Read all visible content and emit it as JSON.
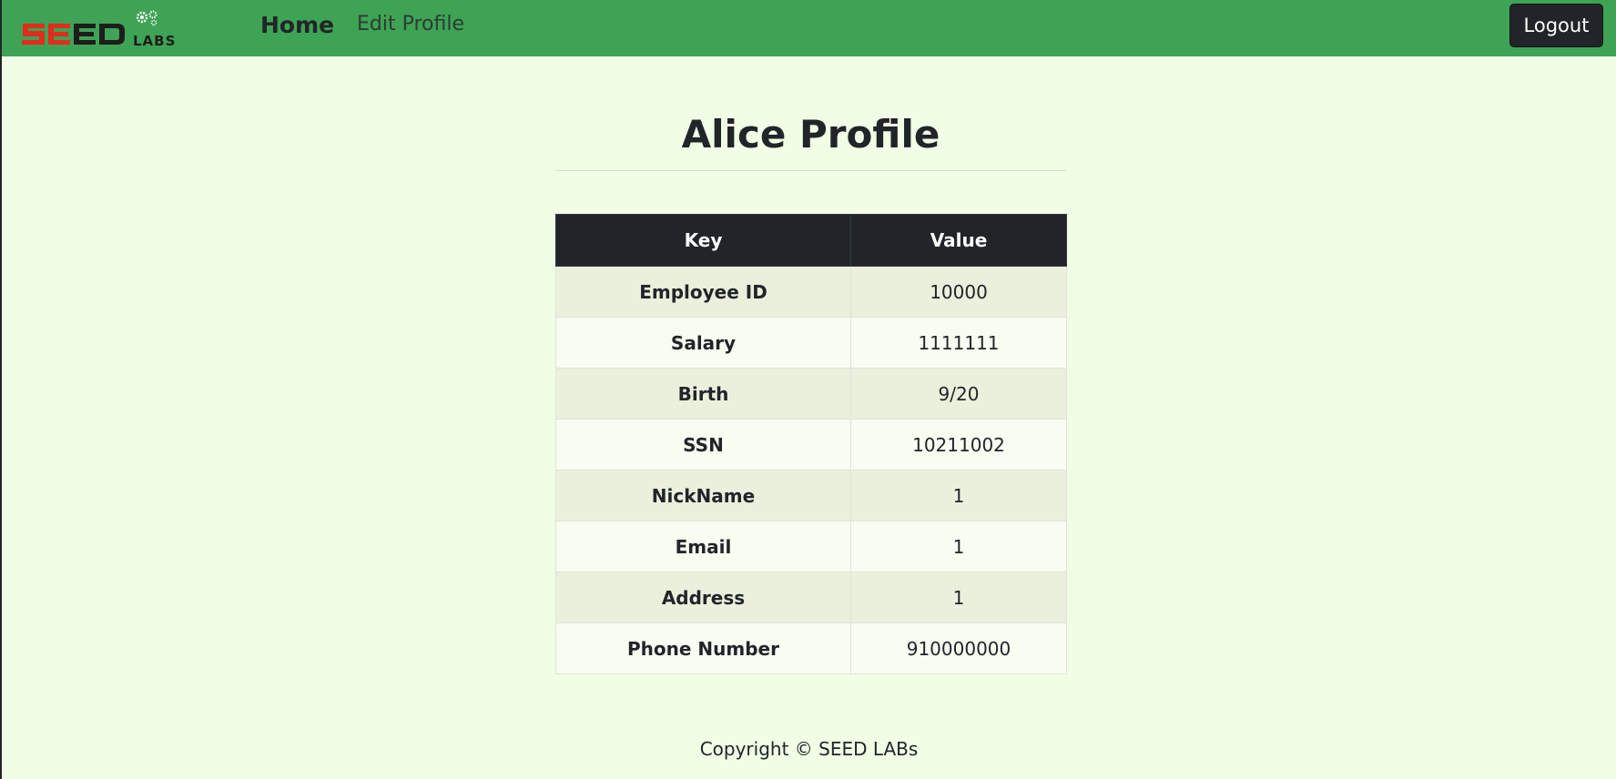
{
  "navbar": {
    "logo_alt": "SEED LABS",
    "home_label": "Home",
    "edit_profile_label": "Edit Profile",
    "logout_label": "Logout",
    "background_color": "#3ea355"
  },
  "main": {
    "title": "Alice Profile",
    "table": {
      "headers": [
        "Key",
        "Value"
      ],
      "rows": [
        {
          "key": "Employee ID",
          "value": "10000"
        },
        {
          "key": "Salary",
          "value": "1111111"
        },
        {
          "key": "Birth",
          "value": "9/20"
        },
        {
          "key": "SSN",
          "value": "10211002"
        },
        {
          "key": "NickName",
          "value": "1"
        },
        {
          "key": "Email",
          "value": "1"
        },
        {
          "key": "Address",
          "value": "1"
        },
        {
          "key": "Phone Number",
          "value": "910000000"
        }
      ]
    }
  },
  "footer": {
    "copyright": "Copyright © SEED LABs"
  },
  "colors": {
    "page_background": "#f1fde5",
    "header_row": "#212529",
    "logo_red": "#e32c1c",
    "logo_dark": "#1d1d1b"
  }
}
